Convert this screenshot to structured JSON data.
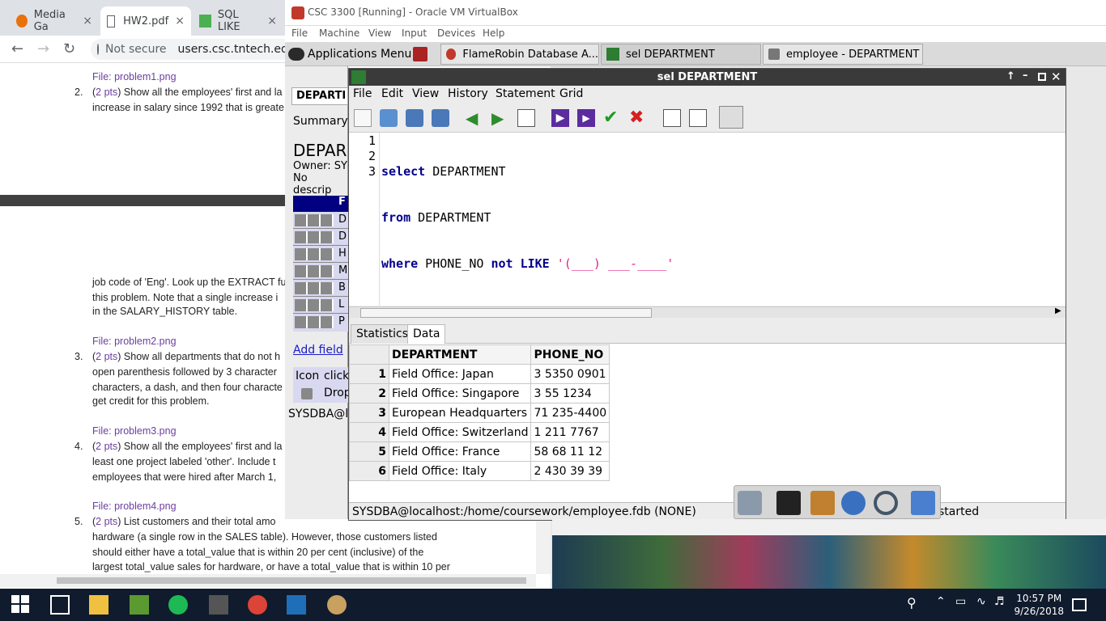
{
  "chrome": {
    "tabs": [
      {
        "label": "Media Ga",
        "close": "×"
      },
      {
        "label": "HW2.pdf",
        "close": "×"
      },
      {
        "label": "SQL LIKE",
        "close": "×"
      }
    ],
    "security_label": "Not secure",
    "url": "users.csc.tntech.edu"
  },
  "pdf": {
    "file1": "File: problem1.png",
    "q2_num": "2.",
    "q2_pts": "2 pts",
    "q2_line1": ") Show all the employees' first and la",
    "q2_line2": "increase in salary since 1992 that is greate",
    "q2_line3": "job code of 'Eng'. Look up the EXTRACT fu",
    "q2_line4": "this problem. Note that a single increase i",
    "q2_line5": "in the SALARY_HISTORY table.",
    "file2": "File: problem2.png",
    "q3_num": "3.",
    "q3_pts": "2 pts",
    "q3_line1": ") Show all departments that do not h",
    "q3_line2": "open parenthesis followed by 3 character",
    "q3_line3": "characters, a dash, and then four characte",
    "q3_line4": "get credit for this problem.",
    "file3": "File: problem3.png",
    "q4_num": "4.",
    "q4_pts": "2 pts",
    "q4_line1": ") Show all the employees' first and la",
    "q4_line2": "least one project labeled 'other'. Include t",
    "q4_line3": "employees that were hired after March 1,",
    "file4": "File: problem4.png",
    "q5_num": "5.",
    "q5_pts": "2 pts",
    "q5_line1": ") List customers and their total amo",
    "q5_line2": "hardware (a single row in the SALES table). However, those customers listed",
    "q5_line3": "should either have a total_value that is within 20 per cent (inclusive) of the",
    "q5_line4": "largest total_value sales for hardware, or have a total_value that is within 10 per"
  },
  "vbox": {
    "title": "CSC 3300 [Running] - Oracle VM VirtualBox",
    "menu": [
      "File",
      "Machine",
      "View",
      "Input",
      "Devices",
      "Help"
    ],
    "guest_tasks": {
      "apps": "Applications Menu",
      "flamerobin": "FlameRobin Database A...",
      "sel": "sel DEPARTMENT",
      "emp": "employee - DEPARTMENT"
    }
  },
  "bg_window": {
    "tab": "DEPARTI",
    "summary": "Summary",
    "heading": "DEPAR",
    "owner": "Owner: SY",
    "desc": "No descrip",
    "col_header": "F",
    "field_letters": [
      "D",
      "D",
      "H",
      "M",
      "B",
      "L",
      "P"
    ],
    "add_field": "Add field",
    "icon_col": "Icon",
    "click_col": "click",
    "drop": "Drop",
    "status": "SYSDBA@lo"
  },
  "sql": {
    "title": "sel DEPARTMENT",
    "menu": [
      "File",
      "Edit",
      "View",
      "History",
      "Statement",
      "Grid"
    ],
    "line_numbers": [
      "1",
      "2",
      "3"
    ],
    "code": {
      "l1_kw": "select",
      "l1_rest": " DEPARTMENT",
      "l2_kw": "from",
      "l2_rest": " DEPARTMENT",
      "l3_kw1": "where",
      "l3_mid": " PHONE_NO ",
      "l3_kw2": "not LIKE",
      "l3_sp": " ",
      "l3_str": "'(___) ___-____'"
    },
    "tabs": [
      "Statistics",
      "Data"
    ],
    "columns": [
      "DEPARTMENT",
      "PHONE_NO"
    ],
    "rows": [
      {
        "n": "1",
        "dept": "Field Office: Japan",
        "phone": "3 5350 0901"
      },
      {
        "n": "2",
        "dept": "Field Office: Singapore",
        "phone": "3 55 1234"
      },
      {
        "n": "3",
        "dept": "European Headquarters",
        "phone": "71 235-4400"
      },
      {
        "n": "4",
        "dept": "Field Office: Switzerland",
        "phone": "1 211 7767"
      },
      {
        "n": "5",
        "dept": "Field Office: France",
        "phone": "58 68 11 12"
      },
      {
        "n": "6",
        "dept": "Field Office: Italy",
        "phone": "2 430 39 39"
      }
    ],
    "status": "SYSDBA@localhost:/home/coursework/employee.fdb (NONE)",
    "status_right": "started"
  },
  "taskbar": {
    "time": "10:57 PM",
    "date": "9/26/2018"
  },
  "colors": {
    "pdf_purple": "#6b3fa0",
    "sql_keyword": "#00008b",
    "sql_string": "#e0218a",
    "title_dark": "#3a3a3a",
    "taskbar": "#101b2d"
  }
}
